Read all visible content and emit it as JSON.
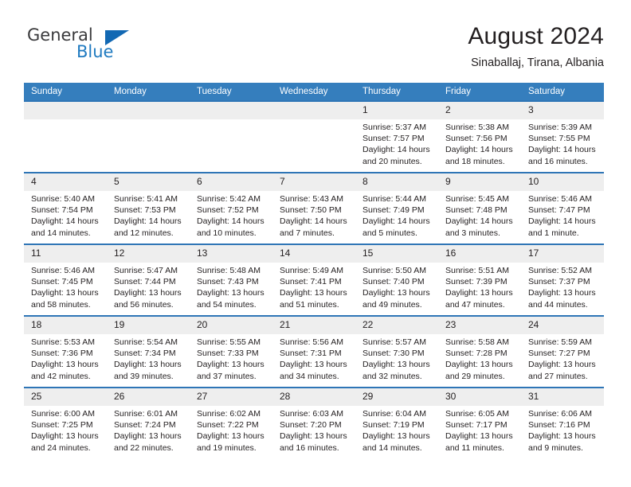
{
  "brand": {
    "name_part1": "General",
    "name_part2": "Blue",
    "triangle_color": "#1268b3",
    "blue_color": "#1f7ac0"
  },
  "header": {
    "title": "August 2024",
    "subtitle": "Sinaballaj, Tirana, Albania"
  },
  "theme": {
    "header_bg": "#357ebd",
    "row_rule": "#2e75b6",
    "daynum_bg": "#eeeeee"
  },
  "weekdays": [
    "Sunday",
    "Monday",
    "Tuesday",
    "Wednesday",
    "Thursday",
    "Friday",
    "Saturday"
  ],
  "labels": {
    "sunrise_prefix": "Sunrise:",
    "sunset_prefix": "Sunset:",
    "daylight_prefix": "Daylight:"
  },
  "weeks": [
    [
      {
        "day": "",
        "sunrise": "",
        "sunset": "",
        "daylight": "",
        "empty": true
      },
      {
        "day": "",
        "sunrise": "",
        "sunset": "",
        "daylight": "",
        "empty": true
      },
      {
        "day": "",
        "sunrise": "",
        "sunset": "",
        "daylight": "",
        "empty": true
      },
      {
        "day": "",
        "sunrise": "",
        "sunset": "",
        "daylight": "",
        "empty": true
      },
      {
        "day": "1",
        "sunrise": "Sunrise: 5:37 AM",
        "sunset": "Sunset: 7:57 PM",
        "daylight": "Daylight: 14 hours and 20 minutes."
      },
      {
        "day": "2",
        "sunrise": "Sunrise: 5:38 AM",
        "sunset": "Sunset: 7:56 PM",
        "daylight": "Daylight: 14 hours and 18 minutes."
      },
      {
        "day": "3",
        "sunrise": "Sunrise: 5:39 AM",
        "sunset": "Sunset: 7:55 PM",
        "daylight": "Daylight: 14 hours and 16 minutes."
      }
    ],
    [
      {
        "day": "4",
        "sunrise": "Sunrise: 5:40 AM",
        "sunset": "Sunset: 7:54 PM",
        "daylight": "Daylight: 14 hours and 14 minutes."
      },
      {
        "day": "5",
        "sunrise": "Sunrise: 5:41 AM",
        "sunset": "Sunset: 7:53 PM",
        "daylight": "Daylight: 14 hours and 12 minutes."
      },
      {
        "day": "6",
        "sunrise": "Sunrise: 5:42 AM",
        "sunset": "Sunset: 7:52 PM",
        "daylight": "Daylight: 14 hours and 10 minutes."
      },
      {
        "day": "7",
        "sunrise": "Sunrise: 5:43 AM",
        "sunset": "Sunset: 7:50 PM",
        "daylight": "Daylight: 14 hours and 7 minutes."
      },
      {
        "day": "8",
        "sunrise": "Sunrise: 5:44 AM",
        "sunset": "Sunset: 7:49 PM",
        "daylight": "Daylight: 14 hours and 5 minutes."
      },
      {
        "day": "9",
        "sunrise": "Sunrise: 5:45 AM",
        "sunset": "Sunset: 7:48 PM",
        "daylight": "Daylight: 14 hours and 3 minutes."
      },
      {
        "day": "10",
        "sunrise": "Sunrise: 5:46 AM",
        "sunset": "Sunset: 7:47 PM",
        "daylight": "Daylight: 14 hours and 1 minute."
      }
    ],
    [
      {
        "day": "11",
        "sunrise": "Sunrise: 5:46 AM",
        "sunset": "Sunset: 7:45 PM",
        "daylight": "Daylight: 13 hours and 58 minutes."
      },
      {
        "day": "12",
        "sunrise": "Sunrise: 5:47 AM",
        "sunset": "Sunset: 7:44 PM",
        "daylight": "Daylight: 13 hours and 56 minutes."
      },
      {
        "day": "13",
        "sunrise": "Sunrise: 5:48 AM",
        "sunset": "Sunset: 7:43 PM",
        "daylight": "Daylight: 13 hours and 54 minutes."
      },
      {
        "day": "14",
        "sunrise": "Sunrise: 5:49 AM",
        "sunset": "Sunset: 7:41 PM",
        "daylight": "Daylight: 13 hours and 51 minutes."
      },
      {
        "day": "15",
        "sunrise": "Sunrise: 5:50 AM",
        "sunset": "Sunset: 7:40 PM",
        "daylight": "Daylight: 13 hours and 49 minutes."
      },
      {
        "day": "16",
        "sunrise": "Sunrise: 5:51 AM",
        "sunset": "Sunset: 7:39 PM",
        "daylight": "Daylight: 13 hours and 47 minutes."
      },
      {
        "day": "17",
        "sunrise": "Sunrise: 5:52 AM",
        "sunset": "Sunset: 7:37 PM",
        "daylight": "Daylight: 13 hours and 44 minutes."
      }
    ],
    [
      {
        "day": "18",
        "sunrise": "Sunrise: 5:53 AM",
        "sunset": "Sunset: 7:36 PM",
        "daylight": "Daylight: 13 hours and 42 minutes."
      },
      {
        "day": "19",
        "sunrise": "Sunrise: 5:54 AM",
        "sunset": "Sunset: 7:34 PM",
        "daylight": "Daylight: 13 hours and 39 minutes."
      },
      {
        "day": "20",
        "sunrise": "Sunrise: 5:55 AM",
        "sunset": "Sunset: 7:33 PM",
        "daylight": "Daylight: 13 hours and 37 minutes."
      },
      {
        "day": "21",
        "sunrise": "Sunrise: 5:56 AM",
        "sunset": "Sunset: 7:31 PM",
        "daylight": "Daylight: 13 hours and 34 minutes."
      },
      {
        "day": "22",
        "sunrise": "Sunrise: 5:57 AM",
        "sunset": "Sunset: 7:30 PM",
        "daylight": "Daylight: 13 hours and 32 minutes."
      },
      {
        "day": "23",
        "sunrise": "Sunrise: 5:58 AM",
        "sunset": "Sunset: 7:28 PM",
        "daylight": "Daylight: 13 hours and 29 minutes."
      },
      {
        "day": "24",
        "sunrise": "Sunrise: 5:59 AM",
        "sunset": "Sunset: 7:27 PM",
        "daylight": "Daylight: 13 hours and 27 minutes."
      }
    ],
    [
      {
        "day": "25",
        "sunrise": "Sunrise: 6:00 AM",
        "sunset": "Sunset: 7:25 PM",
        "daylight": "Daylight: 13 hours and 24 minutes."
      },
      {
        "day": "26",
        "sunrise": "Sunrise: 6:01 AM",
        "sunset": "Sunset: 7:24 PM",
        "daylight": "Daylight: 13 hours and 22 minutes."
      },
      {
        "day": "27",
        "sunrise": "Sunrise: 6:02 AM",
        "sunset": "Sunset: 7:22 PM",
        "daylight": "Daylight: 13 hours and 19 minutes."
      },
      {
        "day": "28",
        "sunrise": "Sunrise: 6:03 AM",
        "sunset": "Sunset: 7:20 PM",
        "daylight": "Daylight: 13 hours and 16 minutes."
      },
      {
        "day": "29",
        "sunrise": "Sunrise: 6:04 AM",
        "sunset": "Sunset: 7:19 PM",
        "daylight": "Daylight: 13 hours and 14 minutes."
      },
      {
        "day": "30",
        "sunrise": "Sunrise: 6:05 AM",
        "sunset": "Sunset: 7:17 PM",
        "daylight": "Daylight: 13 hours and 11 minutes."
      },
      {
        "day": "31",
        "sunrise": "Sunrise: 6:06 AM",
        "sunset": "Sunset: 7:16 PM",
        "daylight": "Daylight: 13 hours and 9 minutes."
      }
    ]
  ]
}
